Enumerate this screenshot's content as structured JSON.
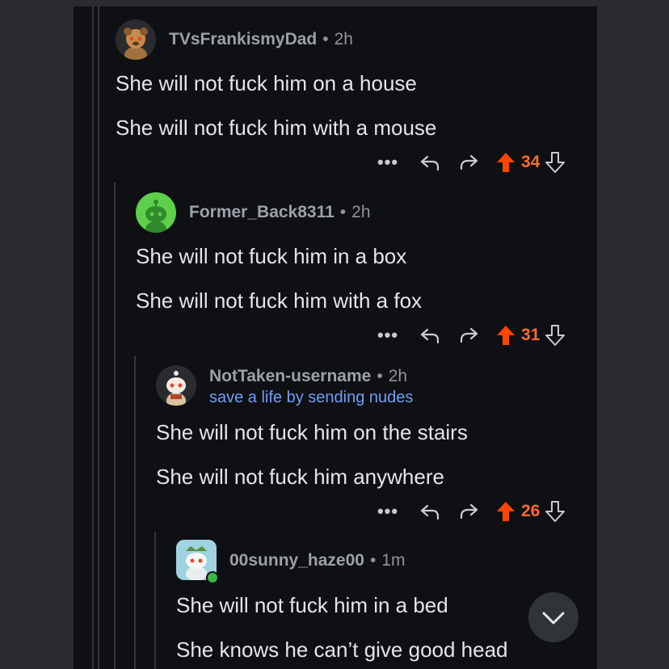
{
  "comments": [
    {
      "username": "TVsFrankismyDad",
      "time": "2h",
      "flair": "",
      "lines": [
        "She will not fuck him on a house",
        "She will not fuck him with a mouse"
      ],
      "score": "34"
    },
    {
      "username": "Former_Back8311",
      "time": "2h",
      "flair": "",
      "lines": [
        "She will not fuck him in a box",
        "She will not fuck him with a fox"
      ],
      "score": "31"
    },
    {
      "username": "NotTaken-username",
      "time": "2h",
      "flair": "save a life by sending nudes",
      "lines": [
        "She will not fuck him on the stairs",
        "She will not fuck him anywhere"
      ],
      "score": "26"
    },
    {
      "username": "00sunny_haze00",
      "time": "1m",
      "flair": "",
      "lines": [
        "She will not fuck him in a bed",
        "She knows he can’t give good head"
      ],
      "score": ""
    }
  ],
  "icons": {
    "more": "more-options-icon",
    "reply": "reply-icon",
    "share": "share-icon",
    "upvote": "upvote-icon",
    "downvote": "downvote-icon",
    "scroll": "chevron-down-icon"
  },
  "colors": {
    "upvote_active": "#ff4500",
    "score_active": "#ff6a33",
    "flair": "#6f9ef5",
    "online": "#3bb54a"
  },
  "ellipsis": "•••"
}
